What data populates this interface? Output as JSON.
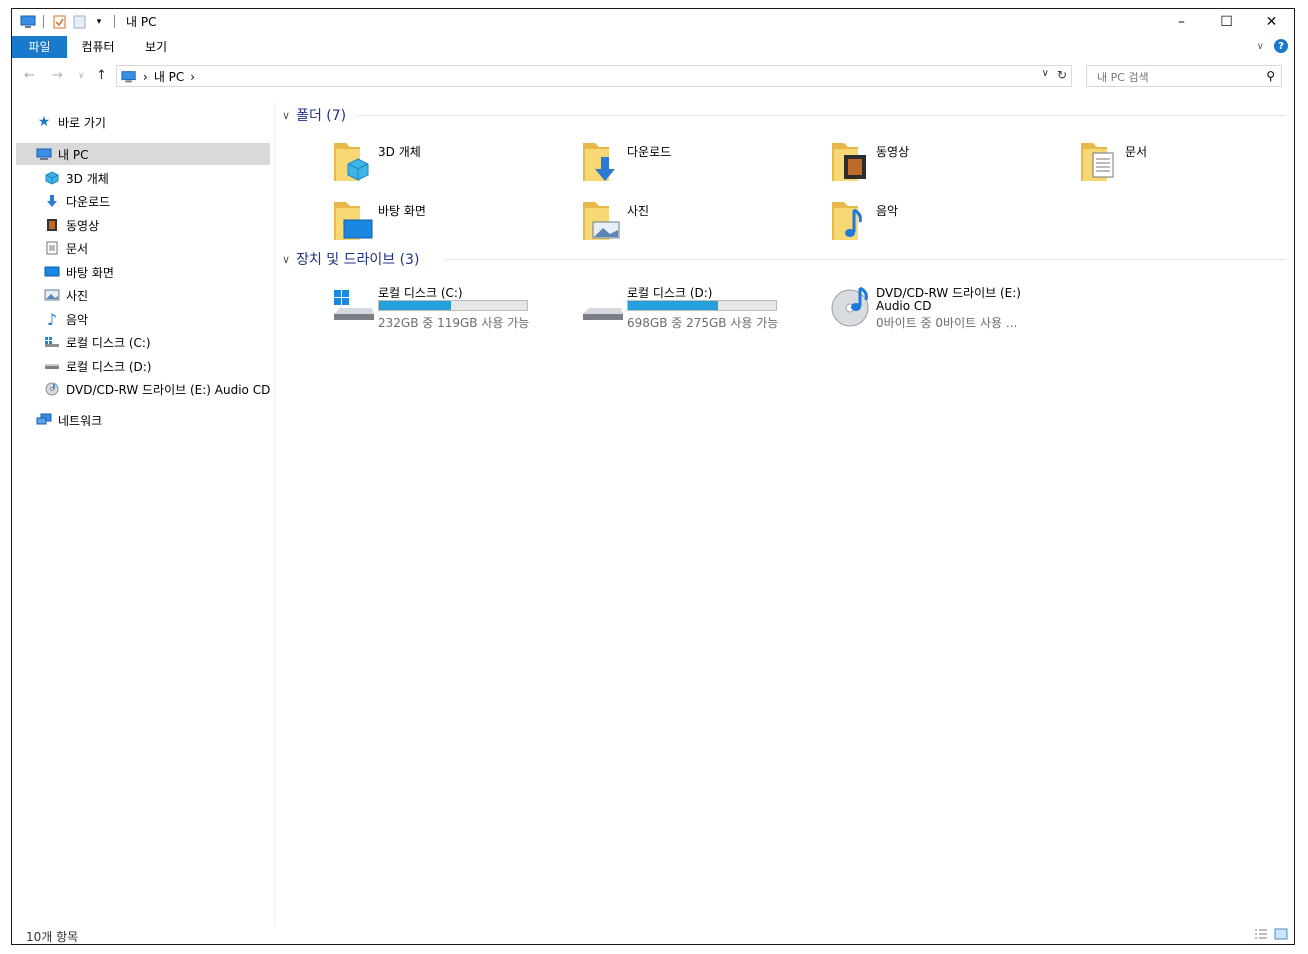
{
  "window": {
    "title": "내 PC",
    "minimize": "–",
    "maximize": "☐",
    "close": "✕"
  },
  "ribbon": {
    "tabs": [
      "파일",
      "컴퓨터",
      "보기"
    ],
    "help": "?"
  },
  "address": {
    "crumbs": [
      "내 PC"
    ],
    "search_placeholder": "내 PC 검색"
  },
  "nav": {
    "quick_access": "바로 가기",
    "this_pc": "내 PC",
    "items": [
      {
        "label": "3D 개체",
        "icon": "cube-icon"
      },
      {
        "label": "다운로드",
        "icon": "download-arrow-icon"
      },
      {
        "label": "동영상",
        "icon": "film-icon"
      },
      {
        "label": "문서",
        "icon": "document-icon"
      },
      {
        "label": "바탕 화면",
        "icon": "desktop-icon"
      },
      {
        "label": "사진",
        "icon": "picture-icon"
      },
      {
        "label": "음악",
        "icon": "music-note-icon"
      },
      {
        "label": "로컬 디스크 (C:)",
        "icon": "windows-drive-icon"
      },
      {
        "label": "로컬 디스크 (D:)",
        "icon": "drive-icon"
      },
      {
        "label": "DVD/CD-RW 드라이브 (E:) Audio CD",
        "icon": "cd-icon"
      }
    ],
    "network": "네트워크"
  },
  "groups": {
    "folders_header": "폴더 (7)",
    "devices_header": "장치 및 드라이브 (3)"
  },
  "folders": [
    {
      "label": "3D 개체",
      "icon": "cube-icon"
    },
    {
      "label": "다운로드",
      "icon": "download-arrow-icon"
    },
    {
      "label": "동영상",
      "icon": "film-icon"
    },
    {
      "label": "문서",
      "icon": "document-icon"
    },
    {
      "label": "바탕 화면",
      "icon": "desktop-icon"
    },
    {
      "label": "사진",
      "icon": "picture-icon"
    },
    {
      "label": "음악",
      "icon": "music-note-icon"
    }
  ],
  "drives": [
    {
      "label": "로컬 디스크 (C:)",
      "free_text": "232GB 중 119GB 사용 가능",
      "used_fraction": 0.487
    },
    {
      "label": "로컬 디스크 (D:)",
      "free_text": "698GB 중 275GB 사용 가능",
      "used_fraction": 0.606
    },
    {
      "label": "DVD/CD-RW 드라이브 (E:)",
      "line2": "Audio CD",
      "free_text": "0바이트 중 0바이트 사용 ..."
    }
  ],
  "status": {
    "count": "10개 항목"
  },
  "colors": {
    "accent": "#1979ca",
    "bar_fill": "#26a0da",
    "group_header": "#1e3287",
    "folder_yellow": "#f8d775"
  }
}
